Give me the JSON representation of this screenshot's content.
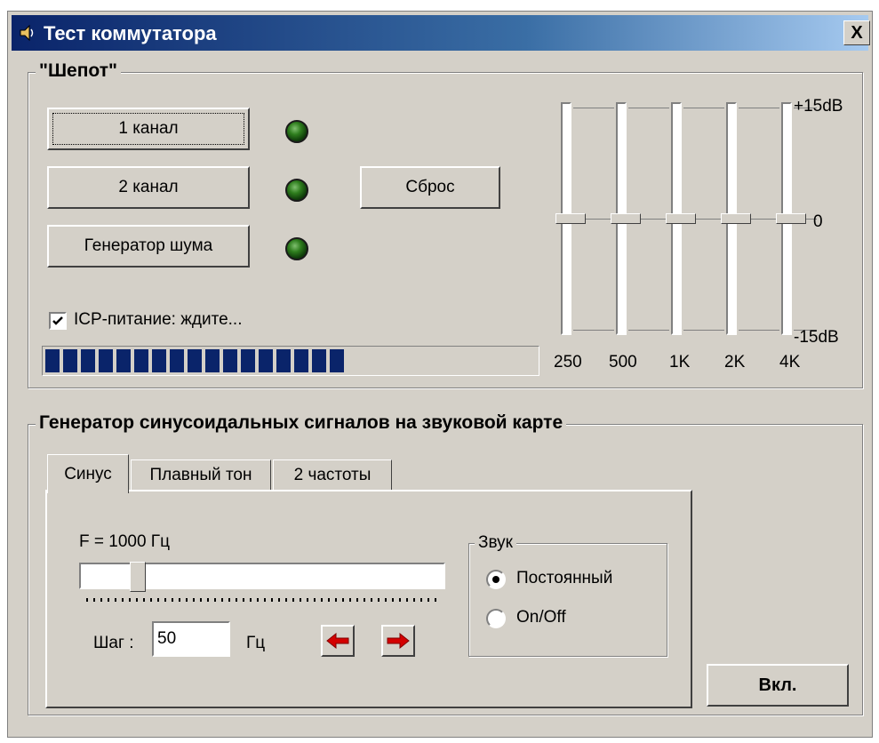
{
  "window": {
    "title": "Тест коммутатора",
    "close_label": "X",
    "icon": "speaker-icon"
  },
  "whisper_group": {
    "title": "\"Шепот\"",
    "channel1_label": "1 канал",
    "channel2_label": "2 канал",
    "noise_label": "Генератор шума",
    "reset_label": "Сброс",
    "icp_checked": true,
    "icp_label": "ICP-питание: ждите...",
    "progress_percent": 60
  },
  "equalizer": {
    "db_top": "+15dB",
    "db_mid": "0",
    "db_bottom": "-15dB",
    "bands": [
      {
        "label": "250",
        "gain_db": 0
      },
      {
        "label": "500",
        "gain_db": 0
      },
      {
        "label": "1K",
        "gain_db": 0
      },
      {
        "label": "2K",
        "gain_db": 0
      },
      {
        "label": "4K",
        "gain_db": 0
      }
    ]
  },
  "generator_group": {
    "title": "Генератор синусоидальных сигналов на звуковой карте",
    "tabs": [
      "Синус",
      "Плавный тон",
      "2 частоты"
    ],
    "active_tab": 0,
    "freq_label": "F = 1000 Гц",
    "freq_slider_fraction": 0.14,
    "step_label": "Шаг :",
    "step_value": "50",
    "step_unit": "Гц",
    "sound_group_title": "Звук",
    "sound_options": [
      "Постоянный",
      "On/Off"
    ],
    "sound_selected": 0,
    "on_label": "Вкл."
  },
  "colors": {
    "title_start": "#0a246a",
    "led_green": "#2e7d1d",
    "progress_fill": "#0a246a",
    "arrow_red": "#d40000"
  }
}
